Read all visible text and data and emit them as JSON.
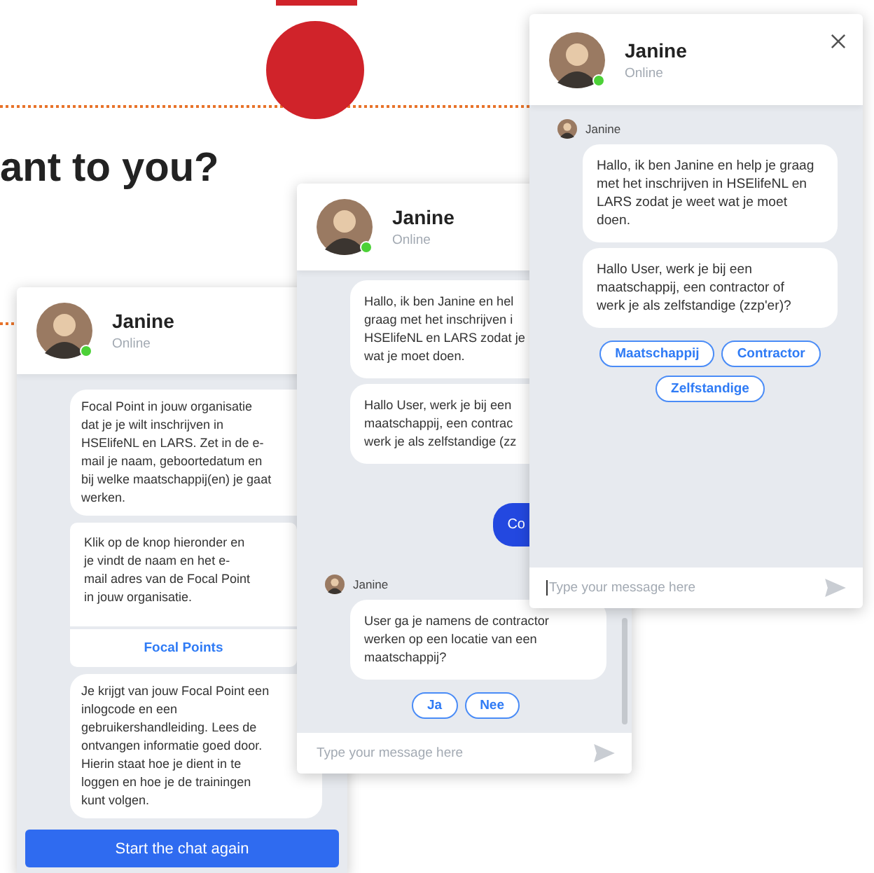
{
  "page": {
    "heading": "ant to you?"
  },
  "chat_windows": [
    {
      "agent": "Janine",
      "status": "Online",
      "online": true,
      "messages": [
        {
          "kind": "bot",
          "text": "Focal Point in jouw organisatie\ndat je je wilt inschrijven in\nHSElifeNL en LARS. Zet in de e-\nmail je naam, geboortedatum en\nbij welke maatschappij(en) je gaat\nwerken."
        },
        {
          "kind": "card",
          "text": "Klik op de knop hieronder en\nje vindt de naam en het e-\nmail adres van de Focal Point\nin jouw organisatie.",
          "button": "Focal Points"
        },
        {
          "kind": "bot",
          "text": "Je krijgt van jouw Focal Point een\ninlogcode en een\ngebruikershandleiding. Lees de\nontvangen informatie goed door.\nHierin staat hoe je dient in te\nloggen en hoe je de trainingen\nkunt volgen."
        }
      ],
      "restart_button": "Start the chat again"
    },
    {
      "agent": "Janine",
      "status": "Online",
      "online": true,
      "messages": [
        {
          "kind": "bot",
          "text": "Hallo, ik ben Janine en hel\ngraag met het inschrijven i\nHSElifeNL en LARS zodat je\nwat je moet doen."
        },
        {
          "kind": "bot",
          "text": "Hallo User, werk je bij een\nmaatschappij, een contrac\nwerk je als zelfstandige (zz"
        },
        {
          "kind": "user",
          "text": "Co"
        },
        {
          "kind": "sender",
          "name": "Janine"
        },
        {
          "kind": "bot",
          "text": "User ga je namens de contractor\nwerken op een locatie van een\nmaatschappij?"
        },
        {
          "kind": "choices",
          "options": [
            "Ja",
            "Nee"
          ]
        }
      ],
      "input": {
        "placeholder": "Type your message here",
        "focused": false
      }
    },
    {
      "agent": "Janine",
      "status": "Online",
      "online": true,
      "closable": true,
      "messages": [
        {
          "kind": "sender",
          "name": "Janine"
        },
        {
          "kind": "bot",
          "text": "Hallo, ik ben Janine en help je graag\nmet het inschrijven in HSElifeNL en\nLARS zodat je weet wat je moet\ndoen."
        },
        {
          "kind": "bot",
          "text": "Hallo User, werk je bij een\nmaatschappij, een contractor of\nwerk je als zelfstandige (zzp'er)?"
        },
        {
          "kind": "choices",
          "options": [
            "Maatschappij",
            "Contractor",
            "Zelfstandige"
          ]
        }
      ],
      "input": {
        "placeholder": "Type your message here",
        "focused": true
      }
    }
  ]
}
